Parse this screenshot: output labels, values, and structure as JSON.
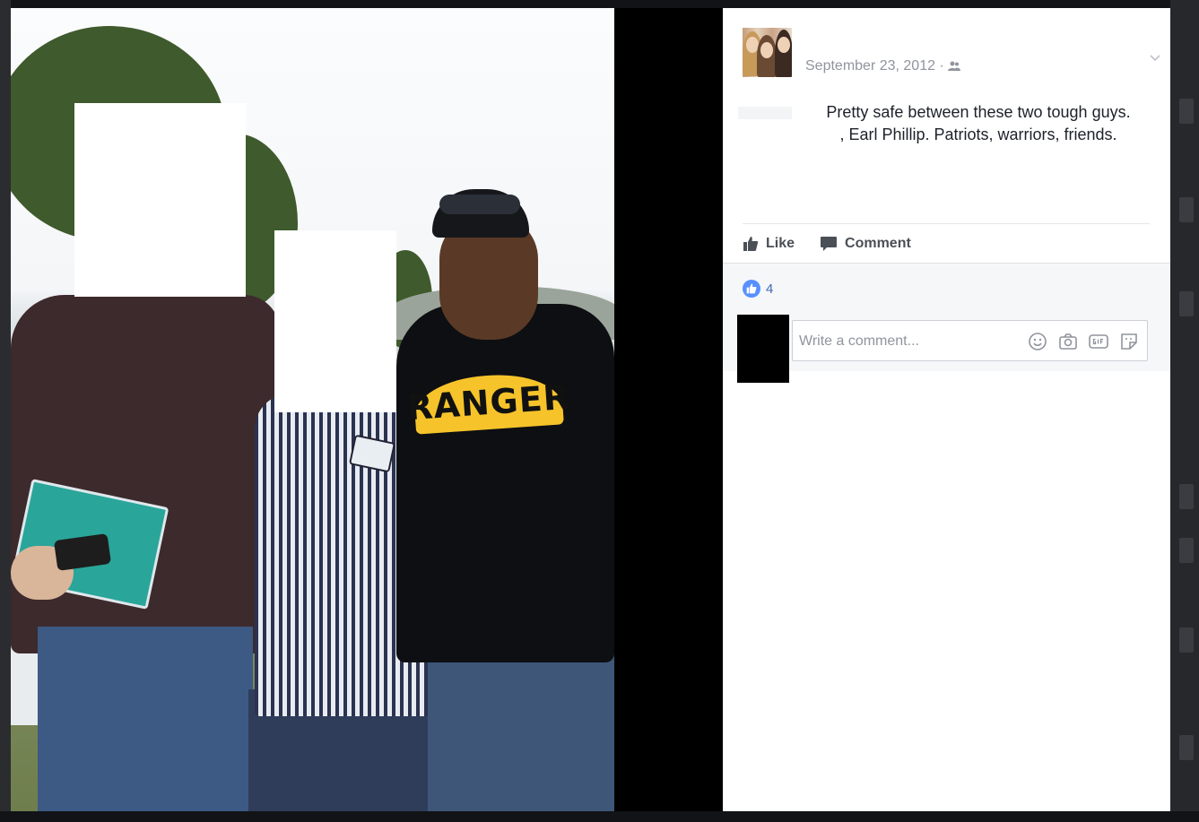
{
  "post": {
    "date": "September 23, 2012 ·",
    "text_line1": "Pretty safe between these two tough guys.",
    "text_line2": ", Earl Phillip. Patriots, warriors, friends."
  },
  "actions": {
    "like_label": "Like",
    "comment_label": "Comment"
  },
  "reactions": {
    "count": "4"
  },
  "comment_box": {
    "placeholder": "Write a comment..."
  },
  "photo": {
    "shirt_text": "RANGER"
  },
  "icons": {
    "options": "chevron-down-icon",
    "audience": "friends-icon",
    "like": "thumbs-up-icon",
    "comment": "speech-bubble-icon",
    "emoji": "smiley-icon",
    "photo": "camera-icon",
    "gif": "gif-icon",
    "sticker": "sticker-icon"
  },
  "colors": {
    "link_blue": "#4267b2",
    "like_badge": "#5890ff",
    "meta_gray": "#90949c",
    "text": "#1d2129",
    "action_gray": "#4b4f56"
  }
}
